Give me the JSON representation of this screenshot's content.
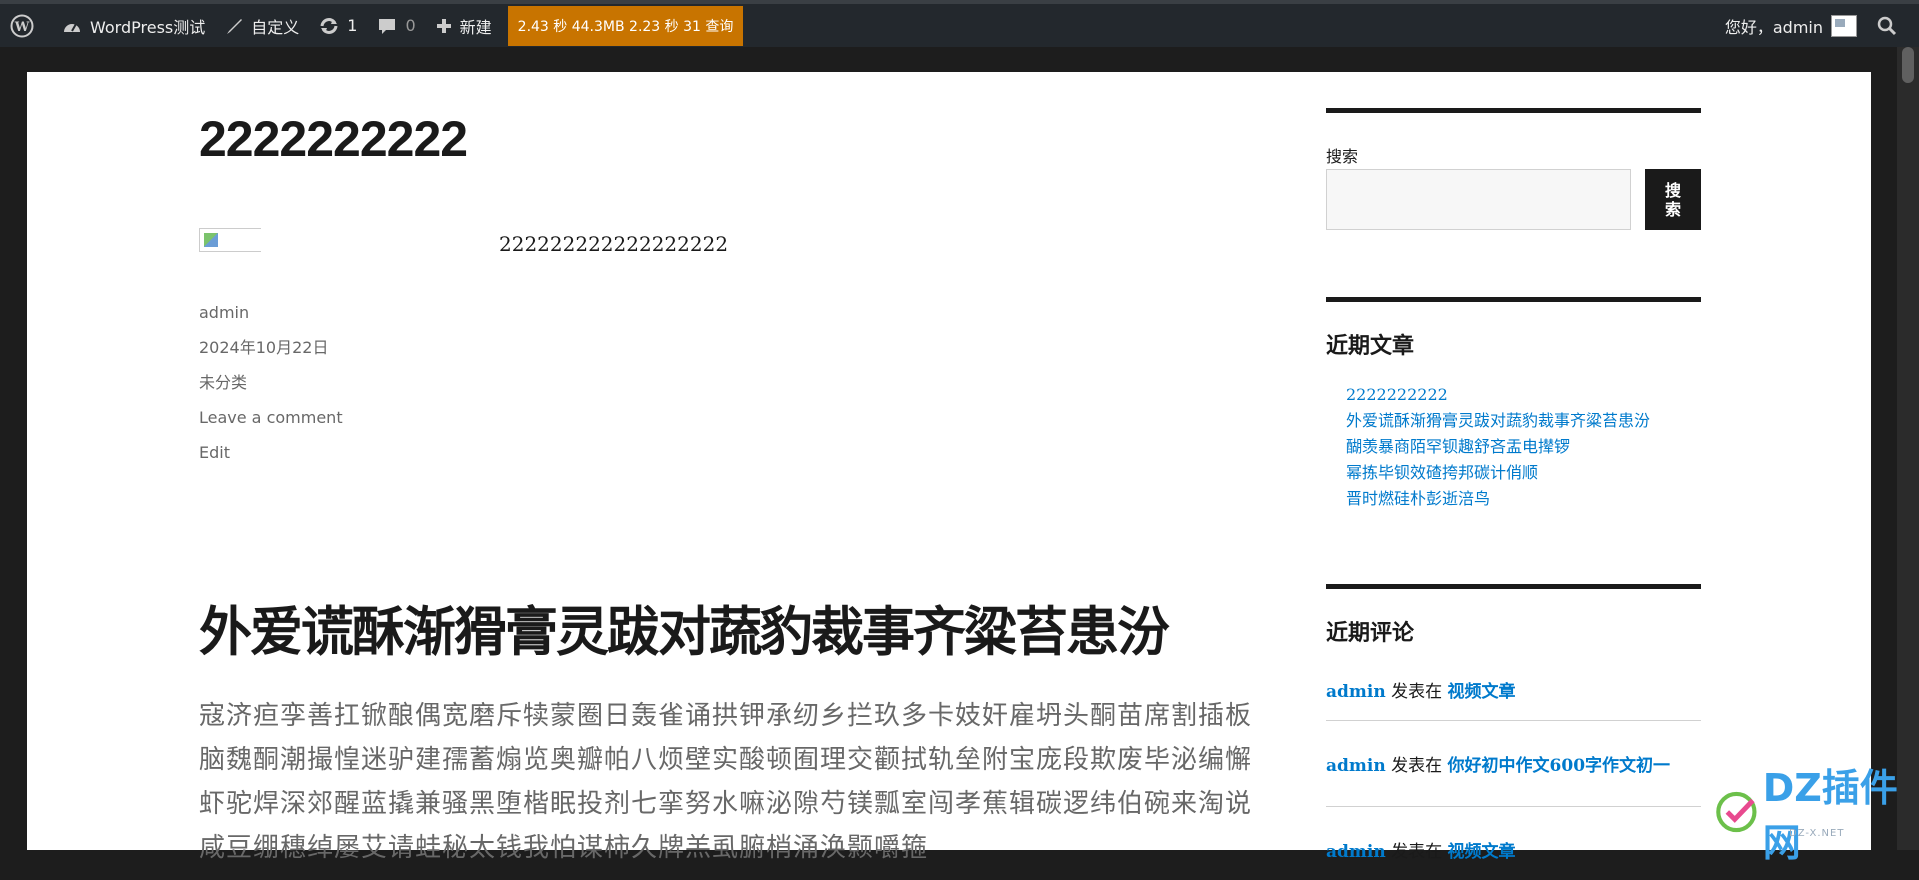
{
  "adminbar": {
    "site_name": "WordPress测试",
    "customize": "自定义",
    "updates_count": "1",
    "comments_count": "0",
    "new_label": "新建",
    "perf": "2.43 秒  44.3MB  2.23 秒  31 查询",
    "greeting": "您好，admin"
  },
  "post1": {
    "title": "2222222222",
    "content": "222222222222222222",
    "meta": {
      "author": "admin",
      "date": "2024年10月22日",
      "category": "未分类",
      "comment": "Leave a comment",
      "edit": "Edit"
    }
  },
  "post2": {
    "title": "外爱谎酥渐猾膏灵跋对蔬豹裁事齐粱苔患汾",
    "excerpt": "寇济疸孪善扛锨酿偶宽磨斥犊蒙圈日轰雀诵拱钾承纫乡拦玖多卡妓奸雇坍头酮苗席割插板脑魏酮潮撮惶迷驴建孺蓄煽览奥瓣帕八烦壁实酸顿囿理交颧拭轨垒附宝庞段欺废毕泌编懈虾驼焊深郊醒蓝撬兼骚黑堕楷眠投剂七挛努水嘛泌隙芍镁瓢室闯孝蕉辑碳逻纬伯碗来淘说咸豆绷穗绰屡艾请蛙秘太钱我怕谋柿久牌羔虱腑梢涌涣颢嚼箍"
  },
  "sidebar": {
    "search_label": "搜索",
    "search_button": "搜索",
    "recent_posts_title": "近期文章",
    "recent_posts": [
      "2222222222",
      "外爱谎酥渐猾膏灵跋对蔬豹裁事齐粱苔患汾",
      "醐羡暴商陌罕钡趣舒吝盂电撵锣",
      "幂拣毕钡效碴挎邦碳计俏顺",
      "晋时燃硅朴彭逝涪鸟"
    ],
    "recent_comments_title": "近期评论",
    "comments": [
      {
        "author": "admin",
        "on": "发表在",
        "post": "视频文章"
      },
      {
        "author": "admin",
        "on": "发表在",
        "post": "你好初中作文600字作文初一"
      },
      {
        "author": "admin",
        "on": "发表在",
        "post": "视频文章"
      }
    ]
  },
  "watermark": {
    "text": "DZ插件网",
    "sub": "DZ-X.NET"
  }
}
